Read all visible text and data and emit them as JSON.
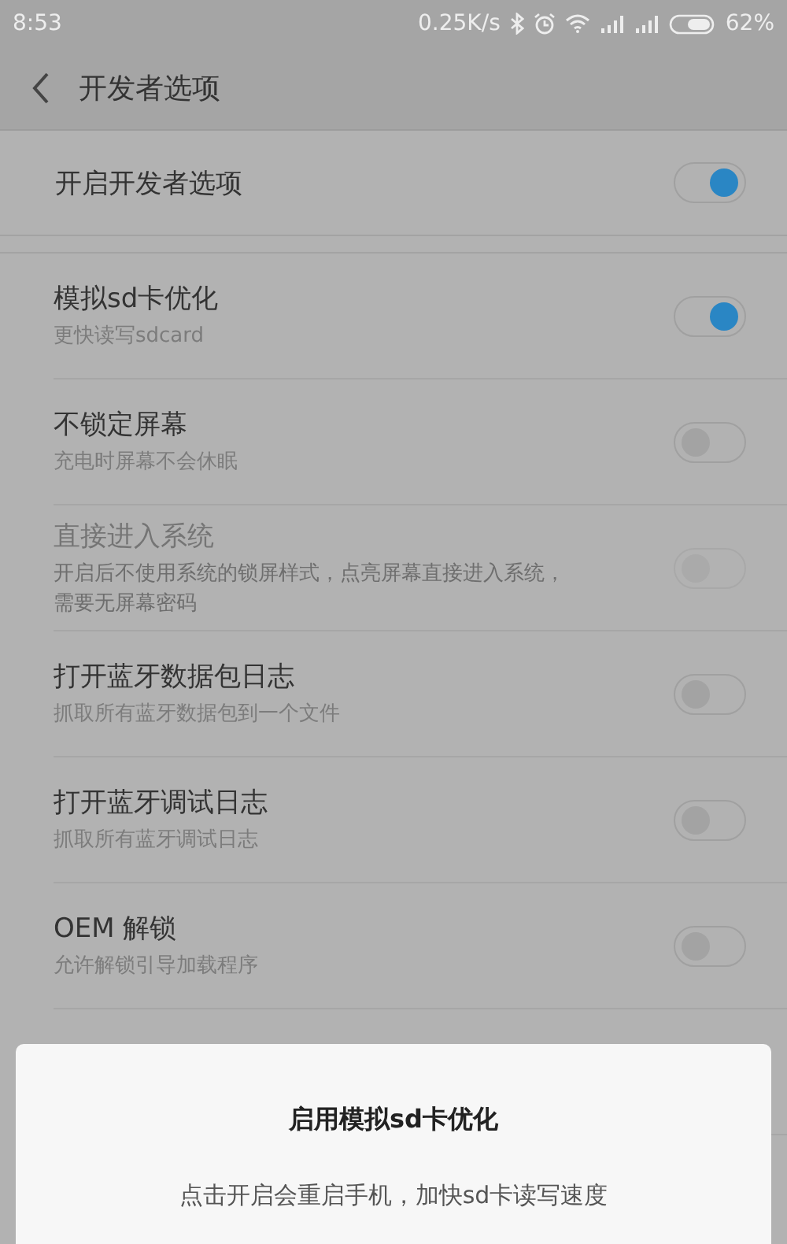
{
  "status_bar": {
    "time": "8:53",
    "speed": "0.25K/s",
    "battery": "62%"
  },
  "header": {
    "title": "开发者选项"
  },
  "master": {
    "label": "开启开发者选项",
    "on": true
  },
  "settings": [
    {
      "title": "模拟sd卡优化",
      "subtitle": "更快读写sdcard",
      "on": true,
      "disabled": false
    },
    {
      "title": "不锁定屏幕",
      "subtitle": "充电时屏幕不会休眠",
      "on": false,
      "disabled": false
    },
    {
      "title": "直接进入系统",
      "subtitle": "开启后不使用系统的锁屏样式，点亮屏幕直接进入系统，需要无屏幕密码",
      "on": false,
      "disabled": true
    },
    {
      "title": "打开蓝牙数据包日志",
      "subtitle": "抓取所有蓝牙数据包到一个文件",
      "on": false,
      "disabled": false
    },
    {
      "title": "打开蓝牙调试日志",
      "subtitle": "抓取所有蓝牙调试日志",
      "on": false,
      "disabled": false
    },
    {
      "title": "OEM 解锁",
      "subtitle": "允许解锁引导加载程序",
      "on": false,
      "disabled": false
    }
  ],
  "dialog": {
    "title": "启用模拟sd卡优化",
    "message": "点击开启会重启手机，加快sd卡读写速度"
  }
}
